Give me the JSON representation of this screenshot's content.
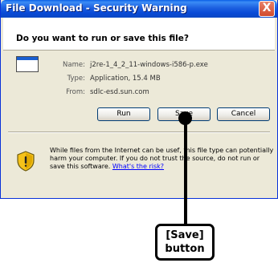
{
  "window": {
    "title": "File Download - Security Warning",
    "close_glyph": "X"
  },
  "dialog": {
    "question": "Do you want to run or save this file?",
    "file": {
      "name_label": "Name:",
      "name_value": "j2re-1_4_2_11-windows-i586-p.exe",
      "type_label": "Type:",
      "type_value": "Application, 15.4 MB",
      "from_label": "From:",
      "from_value": "sdlc-esd.sun.com"
    },
    "buttons": {
      "run": "Run",
      "save": "Save",
      "cancel": "Cancel"
    },
    "warning": {
      "text_1": "While files from the Internet can be usef",
      "text_2": ", this file type can potentially harm your computer. If you do",
      "text_3": "not trust the source, do not run or save this software.",
      "link": "What's the risk?"
    }
  },
  "callout": {
    "line1": "[Save]",
    "line2": "button"
  },
  "icons": {
    "file": "file-exe-icon",
    "shield": "security-shield-icon"
  }
}
